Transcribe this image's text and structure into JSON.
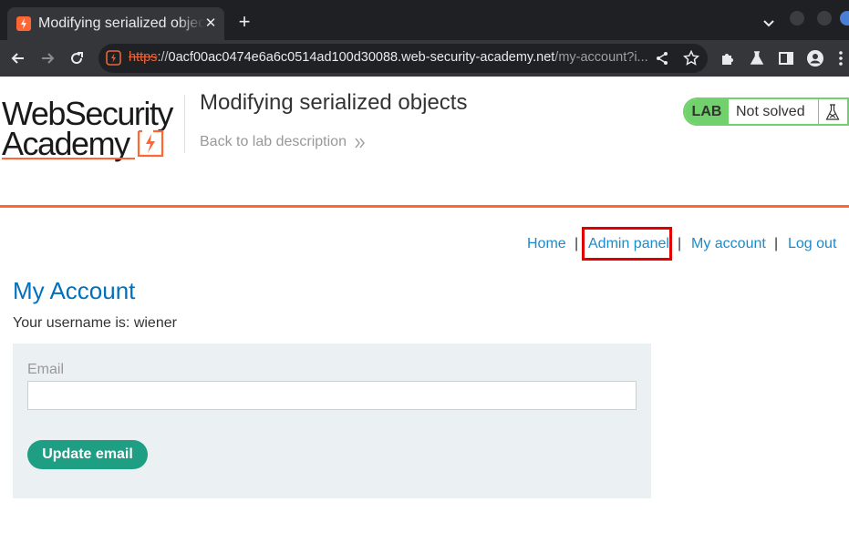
{
  "browser": {
    "tab": {
      "title": "Modifying serialized objects",
      "close_glyph": "✕"
    },
    "new_tab_glyph": "+",
    "url": {
      "scheme": "https",
      "separator": "://",
      "host": "0acf00ac0474e6a6c0514ad100d30088.web-security-academy.net",
      "path": "/my-account?i..."
    }
  },
  "header": {
    "logo": {
      "line1": "WebSecurity",
      "line2": "Academy"
    },
    "lab_title": "Modifying serialized objects",
    "back_link": "Back to lab description",
    "lab_status": {
      "badge": "LAB",
      "state": "Not solved"
    }
  },
  "nav": {
    "home": "Home",
    "admin_panel": "Admin panel",
    "my_account": "My account",
    "log_out": "Log out",
    "separator": "|"
  },
  "main": {
    "heading": "My Account",
    "username_text": "Your username is: wiener",
    "email_label": "Email",
    "email_value": "",
    "update_button": "Update email"
  },
  "colors": {
    "accent": "#ff6633",
    "link": "#1c8bc9",
    "heading": "#0071bc",
    "button": "#1e9e82",
    "lab_green": "#70d16d",
    "highlight": "#e10000"
  }
}
